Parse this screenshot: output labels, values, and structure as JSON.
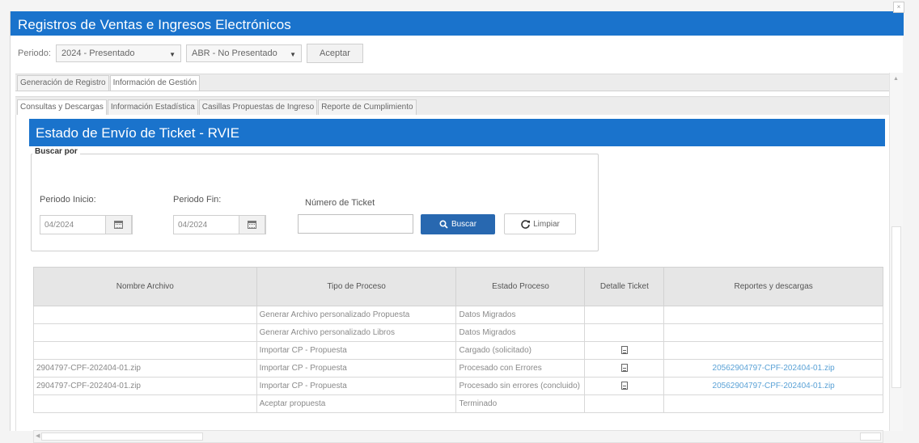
{
  "window": {
    "title": "Registros de Ventas e Ingresos Electrónicos"
  },
  "filter": {
    "periodo_label": "Periodo:",
    "year_value": "2024 - Presentado",
    "month_value": "ABR - No Presentado",
    "accept_label": "Aceptar"
  },
  "tabs_top": [
    {
      "label": "Generación de Registro"
    },
    {
      "label": "Información de Gestión"
    }
  ],
  "tabs_sub": [
    {
      "label": "Consultas y Descargas"
    },
    {
      "label": "Información Estadística"
    },
    {
      "label": "Casillas Propuestas de Ingreso"
    },
    {
      "label": "Reporte de Cumplimiento"
    }
  ],
  "section": {
    "title": "Estado de Envío de Ticket - RVIE"
  },
  "search": {
    "legend": "Buscar por",
    "inicio_label": "Periodo Inicio:",
    "inicio_value": "04/2024",
    "fin_label": "Periodo Fin:",
    "fin_value": "04/2024",
    "ticket_label": "Número de Ticket",
    "ticket_value": "",
    "buscar_label": "Buscar",
    "limpiar_label": "Limpiar"
  },
  "table": {
    "headers": [
      "Nombre Archivo",
      "Tipo de Proceso",
      "Estado Proceso",
      "Detalle Ticket",
      "Reportes y descargas"
    ],
    "rows": [
      {
        "nombre": "",
        "tipo": "Generar Archivo personalizado Propuesta",
        "estado": "Datos Migrados",
        "detalle": false,
        "reporte": ""
      },
      {
        "nombre": "",
        "tipo": "Generar Archivo personalizado Libros",
        "estado": "Datos Migrados",
        "detalle": false,
        "reporte": ""
      },
      {
        "nombre": "",
        "tipo": "Importar CP - Propuesta",
        "estado": "Cargado (solicitado)",
        "detalle": true,
        "reporte": ""
      },
      {
        "nombre": "2904797-CPF-202404-01.zip",
        "tipo": "Importar CP - Propuesta",
        "estado": "Procesado con Errores",
        "detalle": true,
        "reporte": "20562904797-CPF-202404-01.zip"
      },
      {
        "nombre": "2904797-CPF-202404-01.zip",
        "tipo": "Importar CP - Propuesta",
        "estado": "Procesado sin errores (concluido)",
        "detalle": true,
        "reporte": "20562904797-CPF-202404-01.zip"
      },
      {
        "nombre": "",
        "tipo": "Aceptar propuesta",
        "estado": "Terminado",
        "detalle": false,
        "reporte": ""
      }
    ]
  },
  "colors": {
    "header_blue": "#1a73cc",
    "button_blue": "#2868b0",
    "link": "#5ba2d6"
  },
  "icons": [
    "calendar-icon",
    "search-icon",
    "refresh-icon",
    "document-icon"
  ]
}
